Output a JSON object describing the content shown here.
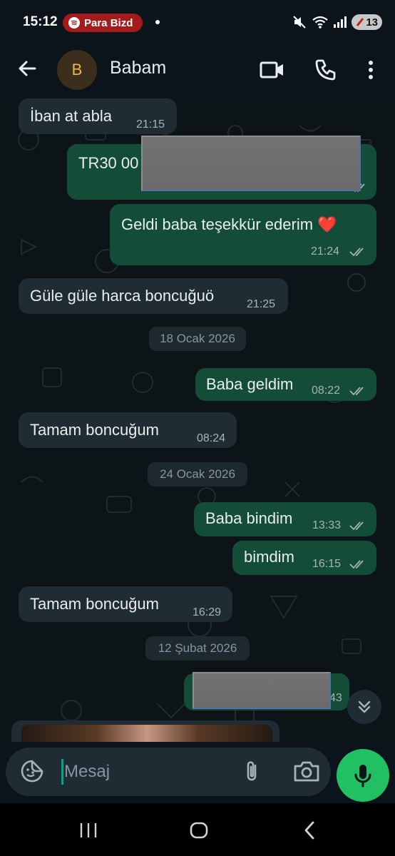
{
  "status_bar": {
    "time": "15:12",
    "media_pill": "Para Bizd",
    "battery": "13"
  },
  "header": {
    "avatar_initial": "B",
    "contact_name": "Babam",
    "icons": [
      "back-arrow-icon",
      "video-call-icon",
      "phone-icon",
      "more-vert-icon"
    ]
  },
  "messages": [
    {
      "dir": "in",
      "text": "İban at abla",
      "time": "21:15"
    },
    {
      "dir": "out",
      "text": "TR30 00",
      "time": "",
      "redacted": true
    },
    {
      "dir": "out",
      "text": "Geldi baba teşekkür ederim ❤️",
      "time": "21:24",
      "read": true
    },
    {
      "dir": "in",
      "text": "Güle güle harca boncuğuö",
      "time": "21:25"
    },
    {
      "dir": "out",
      "text": "Baba geldim",
      "time": "08:22",
      "read": true
    },
    {
      "dir": "in",
      "text": "Tamam  boncuğum",
      "time": "08:24"
    },
    {
      "dir": "out",
      "text": "Baba bindim",
      "time": "13:33",
      "read": true
    },
    {
      "dir": "out",
      "text": "bimdim",
      "time": "16:15",
      "read": true
    },
    {
      "dir": "in",
      "text": "Tamam boncuğum",
      "time": "16:29"
    },
    {
      "dir": "out",
      "text": "",
      "time": "43",
      "redacted": true
    }
  ],
  "date_separators": [
    "18 Ocak 2026",
    "24 Ocak 2026",
    "12 Şubat 2026"
  ],
  "composer": {
    "placeholder": "Mesaj"
  },
  "colors": {
    "background": "#0b141a",
    "incoming_bubble": "#202c33",
    "outgoing_bubble": "#144d37",
    "accent": "#21c063",
    "read_tick": "#a7b3ba"
  }
}
